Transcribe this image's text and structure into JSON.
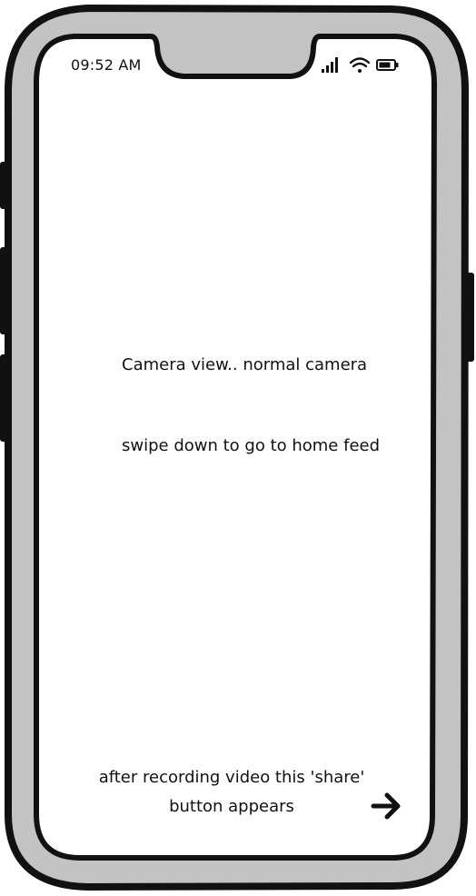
{
  "status_bar": {
    "time": "09:52 AM",
    "signal_icon": "signal-bars-icon",
    "wifi_icon": "wifi-icon",
    "battery_icon": "battery-icon"
  },
  "screen": {
    "camera_note": "Camera view.. normal camera",
    "swipe_note": "swipe down to go to home feed",
    "share_note": "after recording video this 'share' button appears",
    "share_icon": "arrow-right-icon"
  }
}
